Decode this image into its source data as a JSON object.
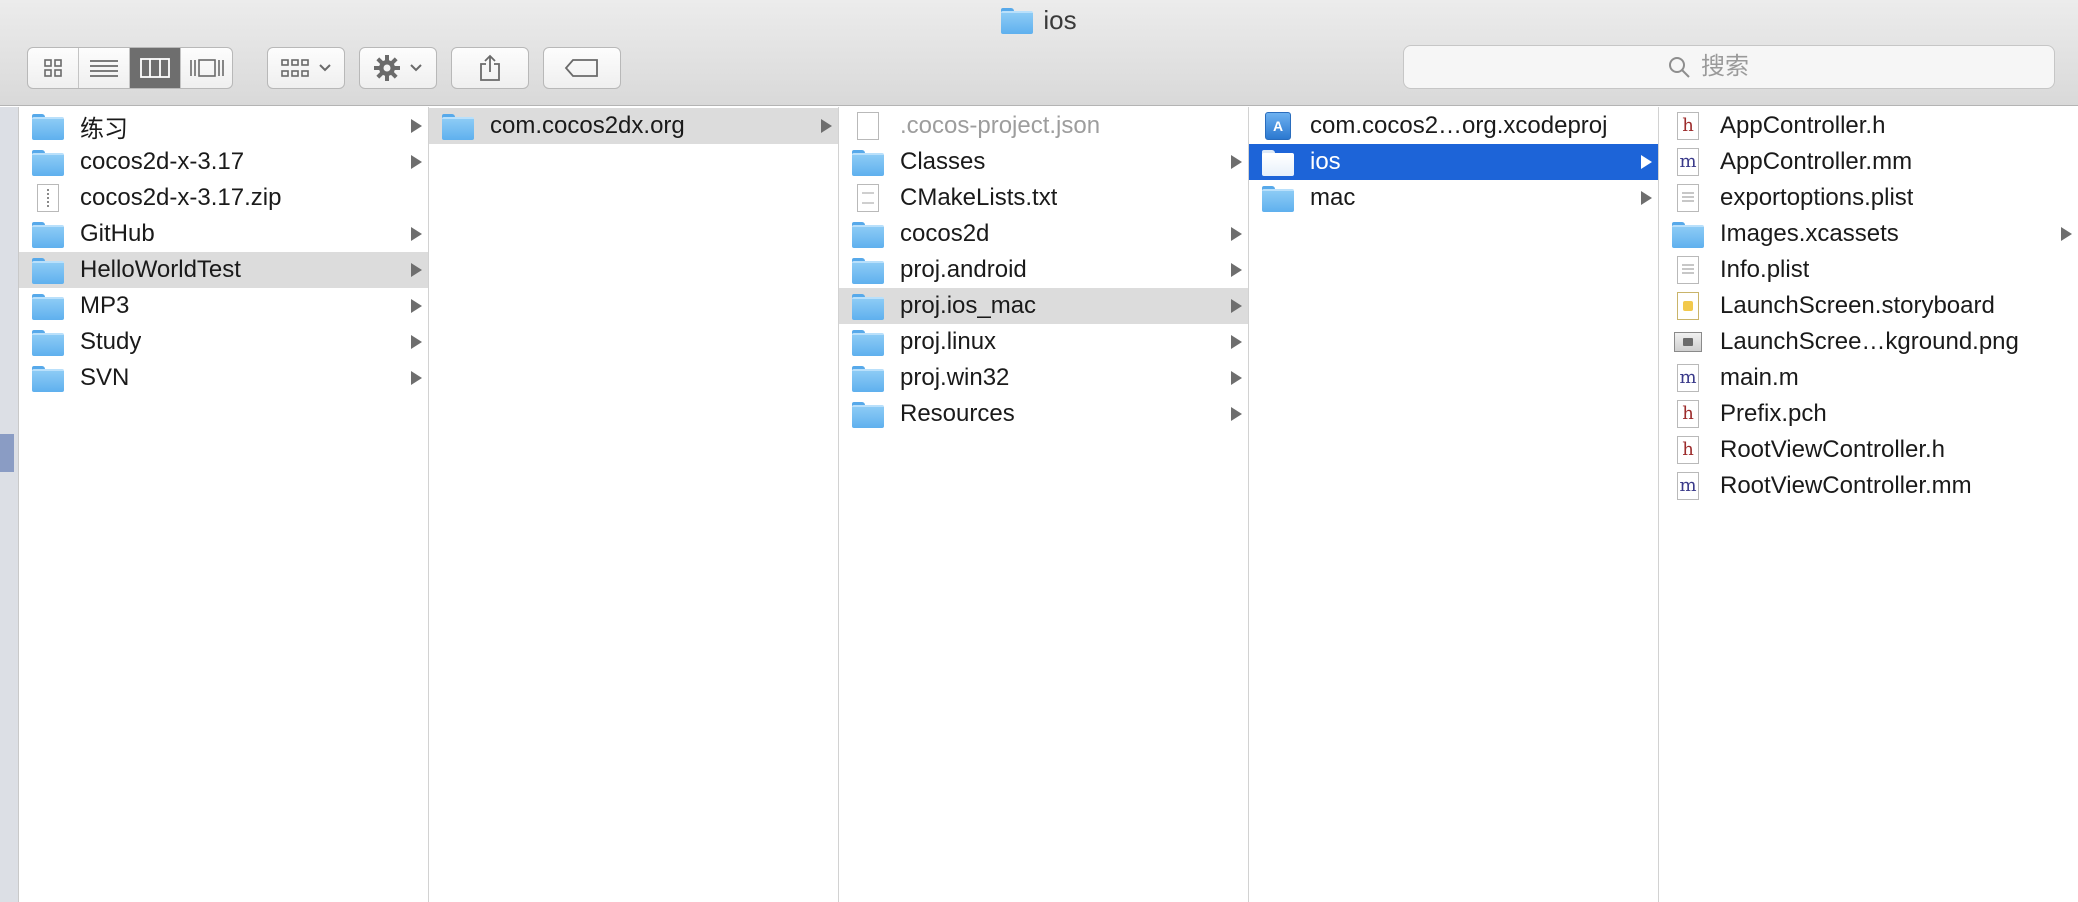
{
  "window": {
    "title": "ios"
  },
  "toolbar": {
    "view_modes": [
      "icon-view",
      "list-view",
      "column-view",
      "cover-flow-view"
    ],
    "active_view": "column-view",
    "search_placeholder": "搜索"
  },
  "colors": {
    "selection_blue": "#1d64d8",
    "selection_grey": "#dcdcdc",
    "folder_blue": "#5fb0ee"
  },
  "columns": [
    {
      "items": [
        {
          "name": "练习",
          "kind": "folder",
          "arrow": true
        },
        {
          "name": "cocos2d-x-3.17",
          "kind": "folder",
          "arrow": true
        },
        {
          "name": "cocos2d-x-3.17.zip",
          "kind": "zip",
          "arrow": false
        },
        {
          "name": "GitHub",
          "kind": "folder",
          "arrow": true
        },
        {
          "name": "HelloWorldTest",
          "kind": "folder",
          "arrow": true,
          "state": "path"
        },
        {
          "name": "MP3",
          "kind": "folder",
          "arrow": true
        },
        {
          "name": "Study",
          "kind": "folder",
          "arrow": true
        },
        {
          "name": "SVN",
          "kind": "folder",
          "arrow": true
        }
      ]
    },
    {
      "items": [
        {
          "name": "com.cocos2dx.org",
          "kind": "folder",
          "arrow": true,
          "state": "path"
        }
      ]
    },
    {
      "items": [
        {
          "name": ".cocos-project.json",
          "kind": "doc",
          "arrow": false,
          "dim": true
        },
        {
          "name": "Classes",
          "kind": "folder",
          "arrow": true
        },
        {
          "name": "CMakeLists.txt",
          "kind": "txt",
          "arrow": false
        },
        {
          "name": "cocos2d",
          "kind": "folder",
          "arrow": true
        },
        {
          "name": "proj.android",
          "kind": "folder",
          "arrow": true
        },
        {
          "name": "proj.ios_mac",
          "kind": "folder",
          "arrow": true,
          "state": "path"
        },
        {
          "name": "proj.linux",
          "kind": "folder",
          "arrow": true
        },
        {
          "name": "proj.win32",
          "kind": "folder",
          "arrow": true
        },
        {
          "name": "Resources",
          "kind": "folder",
          "arrow": true
        }
      ]
    },
    {
      "items": [
        {
          "name": "com.cocos2…org.xcodeproj",
          "kind": "xcodeproj",
          "arrow": false
        },
        {
          "name": "ios",
          "kind": "folder",
          "arrow": true,
          "state": "selected"
        },
        {
          "name": "mac",
          "kind": "folder",
          "arrow": true
        }
      ]
    },
    {
      "items": [
        {
          "name": "AppController.h",
          "kind": "h",
          "arrow": false
        },
        {
          "name": "AppController.mm",
          "kind": "m",
          "arrow": false
        },
        {
          "name": "exportoptions.plist",
          "kind": "plist",
          "arrow": false
        },
        {
          "name": "Images.xcassets",
          "kind": "folder",
          "arrow": true
        },
        {
          "name": "Info.plist",
          "kind": "plist",
          "arrow": false
        },
        {
          "name": "LaunchScreen.storyboard",
          "kind": "storyboard",
          "arrow": false
        },
        {
          "name": "LaunchScree…kground.png",
          "kind": "png",
          "arrow": false
        },
        {
          "name": "main.m",
          "kind": "m",
          "arrow": false
        },
        {
          "name": "Prefix.pch",
          "kind": "h",
          "arrow": false
        },
        {
          "name": "RootViewController.h",
          "kind": "h",
          "arrow": false
        },
        {
          "name": "RootViewController.mm",
          "kind": "m",
          "arrow": false
        }
      ]
    }
  ]
}
